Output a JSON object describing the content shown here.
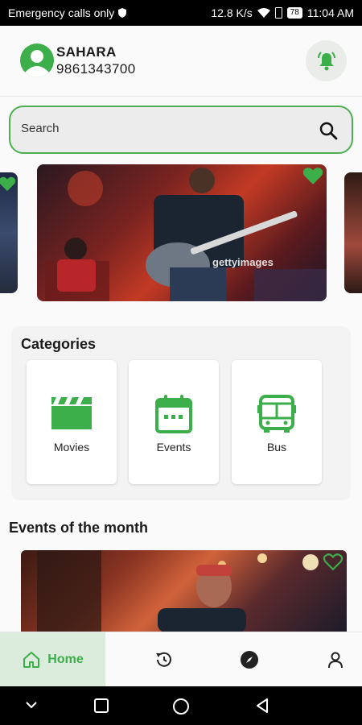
{
  "status_bar": {
    "left_text": "Emergency calls only",
    "speed": "12.8 K/s",
    "battery": "78",
    "time": "11:04 AM"
  },
  "header": {
    "user_name": "SAHARA",
    "phone": "9861343700",
    "notification_icon": "bell-icon"
  },
  "search": {
    "placeholder": "Search",
    "icon": "search-icon"
  },
  "carousel": {
    "watermark": "gettyimages",
    "favorite_icon": "heart-icon"
  },
  "categories": {
    "title": "Categories",
    "items": [
      {
        "label": "Movies",
        "icon": "clapperboard-icon"
      },
      {
        "label": "Events",
        "icon": "calendar-icon"
      },
      {
        "label": "Bus",
        "icon": "bus-icon"
      }
    ]
  },
  "events_of_month": {
    "title": "Events of the month"
  },
  "bottom_nav": {
    "home_label": "Home",
    "items": [
      "home-icon",
      "history-icon",
      "compass-icon",
      "profile-icon"
    ]
  },
  "colors": {
    "accent": "#3cae4a",
    "home_tab_bg": "#dcecdc"
  }
}
